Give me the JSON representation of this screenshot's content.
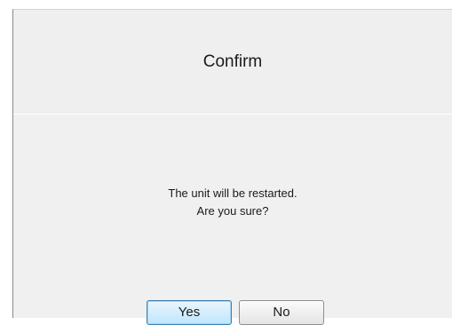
{
  "dialog": {
    "title": "Confirm",
    "message_line1": "The unit will be restarted.",
    "message_line2": "Are you sure?",
    "buttons": {
      "yes_label": "Yes",
      "no_label": "No"
    }
  },
  "colors": {
    "dialog_background": "#f0f0f0",
    "default_button_border": "#3c7fb1"
  }
}
